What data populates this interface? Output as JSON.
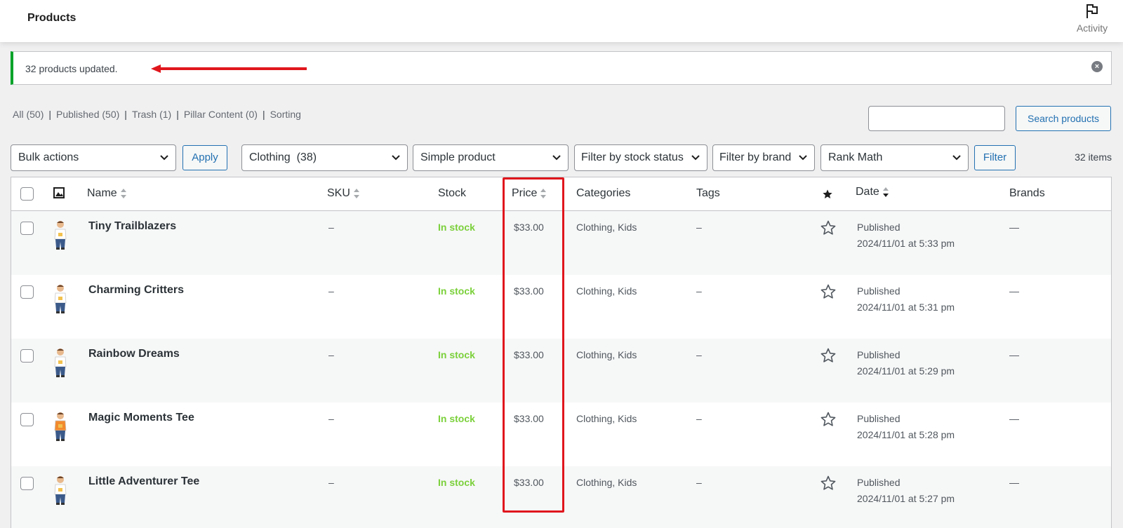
{
  "header": {
    "title": "Products",
    "activity_label": "Activity"
  },
  "notice": {
    "text": "32 products updated.",
    "annotation_color": "#e0161d",
    "status_color": "#00a32a"
  },
  "views": [
    {
      "label": "All",
      "count": "(50)"
    },
    {
      "label": "Published",
      "count": "(50)"
    },
    {
      "label": "Trash",
      "count": "(1)"
    },
    {
      "label": "Pillar Content",
      "count": "(0)"
    },
    {
      "label": "Sorting",
      "count": ""
    }
  ],
  "search": {
    "value": "",
    "button_label": "Search products"
  },
  "filters": {
    "bulk_actions": "Bulk actions",
    "apply_label": "Apply",
    "category": "Clothing  (38)",
    "product_type": "Simple product",
    "stock_status": "Filter by stock status",
    "brand": "Filter by brand",
    "rank_math": "Rank Math",
    "filter_label": "Filter",
    "items_count": "32 items"
  },
  "columns": {
    "name": "Name",
    "sku": "SKU",
    "stock": "Stock",
    "price": "Price",
    "categories": "Categories",
    "tags": "Tags",
    "date": "Date",
    "brands": "Brands"
  },
  "products": [
    {
      "name": "Tiny Trailblazers",
      "sku": "–",
      "stock": "In stock",
      "price": "$33.00",
      "categories": "Clothing, Kids",
      "tags": "–",
      "status": "Published",
      "date": "2024/11/01 at 5:33 pm",
      "brand": "—",
      "shirt": "#ffffff"
    },
    {
      "name": "Charming Critters",
      "sku": "–",
      "stock": "In stock",
      "price": "$33.00",
      "categories": "Clothing, Kids",
      "tags": "–",
      "status": "Published",
      "date": "2024/11/01 at 5:31 pm",
      "brand": "—",
      "shirt": "#ffffff"
    },
    {
      "name": "Rainbow Dreams",
      "sku": "–",
      "stock": "In stock",
      "price": "$33.00",
      "categories": "Clothing, Kids",
      "tags": "–",
      "status": "Published",
      "date": "2024/11/01 at 5:29 pm",
      "brand": "—",
      "shirt": "#ffffff"
    },
    {
      "name": "Magic Moments Tee",
      "sku": "–",
      "stock": "In stock",
      "price": "$33.00",
      "categories": "Clothing, Kids",
      "tags": "–",
      "status": "Published",
      "date": "2024/11/01 at 5:28 pm",
      "brand": "—",
      "shirt": "#f28a2e"
    },
    {
      "name": "Little Adventurer Tee",
      "sku": "–",
      "stock": "In stock",
      "price": "$33.00",
      "categories": "Clothing, Kids",
      "tags": "–",
      "status": "Published",
      "date": "2024/11/01 at 5:27 pm",
      "brand": "—",
      "shirt": "#ffffff"
    }
  ]
}
